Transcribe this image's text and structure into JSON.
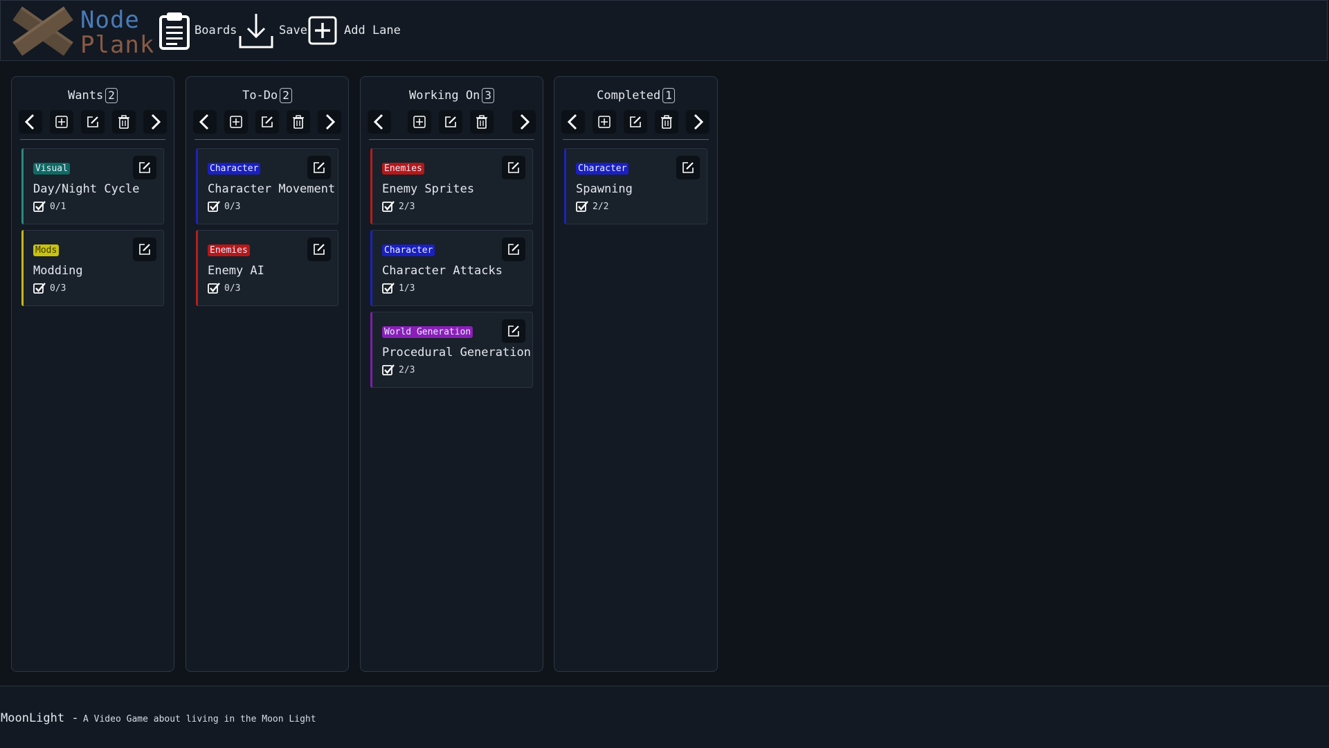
{
  "app": {
    "logo_line1": "Node",
    "logo_line2": "Plank"
  },
  "nav": {
    "boards": "Boards",
    "save": "Save",
    "add_lane": "Add Lane"
  },
  "lanes": [
    {
      "title": "Wants",
      "count": "2",
      "cards": [
        {
          "tag": "Visual",
          "tag_color": "#0e6b63",
          "accent": "#2a8a80",
          "title": "Day/Night Cycle",
          "progress": "0/1"
        },
        {
          "tag": "Mods",
          "tag_color": "#c9c20f",
          "accent": "#c9b80f",
          "title": "Modding",
          "progress": "0/3"
        }
      ]
    },
    {
      "title": "To-Do",
      "count": "2",
      "cards": [
        {
          "tag": "Character",
          "tag_color": "#1a1fc2",
          "accent": "#1d23b8",
          "title": "Character Movement",
          "progress": "0/3"
        },
        {
          "tag": "Enemies",
          "tag_color": "#b81717",
          "accent": "#b81c1c",
          "title": "Enemy AI",
          "progress": "0/3"
        }
      ]
    },
    {
      "title": "Working On",
      "count": "3",
      "cards": [
        {
          "tag": "Enemies",
          "tag_color": "#b81717",
          "accent": "#b81c1c",
          "title": "Enemy Sprites",
          "progress": "2/3"
        },
        {
          "tag": "Character",
          "tag_color": "#1a1fc2",
          "accent": "#1d23b8",
          "title": "Character Attacks",
          "progress": "1/3"
        },
        {
          "tag": "World Generation",
          "tag_color": "#8a1fb8",
          "accent": "#7b20a8",
          "title": "Procedural Generation",
          "progress": "2/3"
        }
      ]
    },
    {
      "title": "Completed",
      "count": "1",
      "cards": [
        {
          "tag": "Character",
          "tag_color": "#1a1fc2",
          "accent": "#1d23b8",
          "title": "Spawning",
          "progress": "2/2"
        }
      ]
    }
  ],
  "footer": {
    "board_name": "MoonLight",
    "separator": "-",
    "description": "A Video Game about living in the Moon Light"
  }
}
